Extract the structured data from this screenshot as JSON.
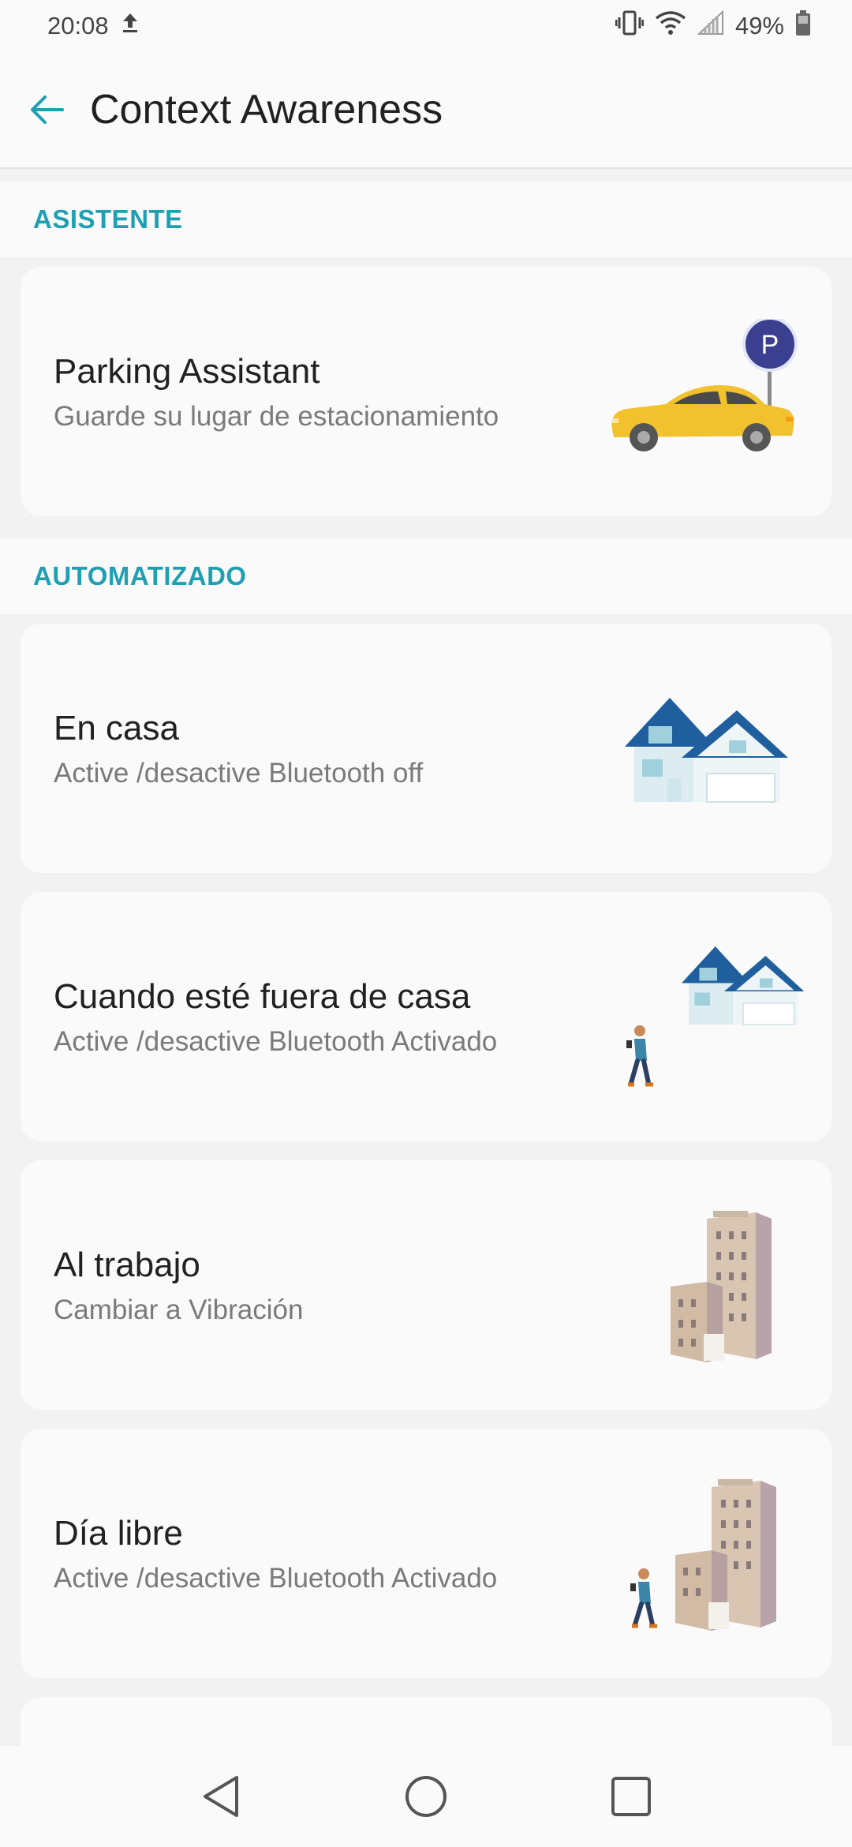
{
  "status_bar": {
    "time": "20:08",
    "battery": "49%"
  },
  "app_bar": {
    "title": "Context Awareness"
  },
  "sections": {
    "assistant": "ASISTENTE",
    "automated": "AUTOMATIZADO"
  },
  "cards": [
    {
      "title": "Parking Assistant",
      "subtitle": "Guarde su lugar de estacionamiento",
      "icon": "parking-car-icon"
    },
    {
      "title": "En casa",
      "subtitle": "Active /desactive Bluetooth off",
      "icon": "house-icon"
    },
    {
      "title": "Cuando esté fuera de casa",
      "subtitle": "Active /desactive Bluetooth Activado",
      "icon": "leaving-house-icon"
    },
    {
      "title": "Al trabajo",
      "subtitle": "Cambiar a Vibración",
      "icon": "office-building-icon"
    },
    {
      "title": "Día libre",
      "subtitle": "Active /desactive Bluetooth Activado",
      "icon": "leaving-building-icon"
    }
  ],
  "colors": {
    "accent": "#1f9fb2",
    "car": "#f2c12e",
    "parking_sign": "#3b3f8f",
    "roof": "#1f5f9e"
  }
}
